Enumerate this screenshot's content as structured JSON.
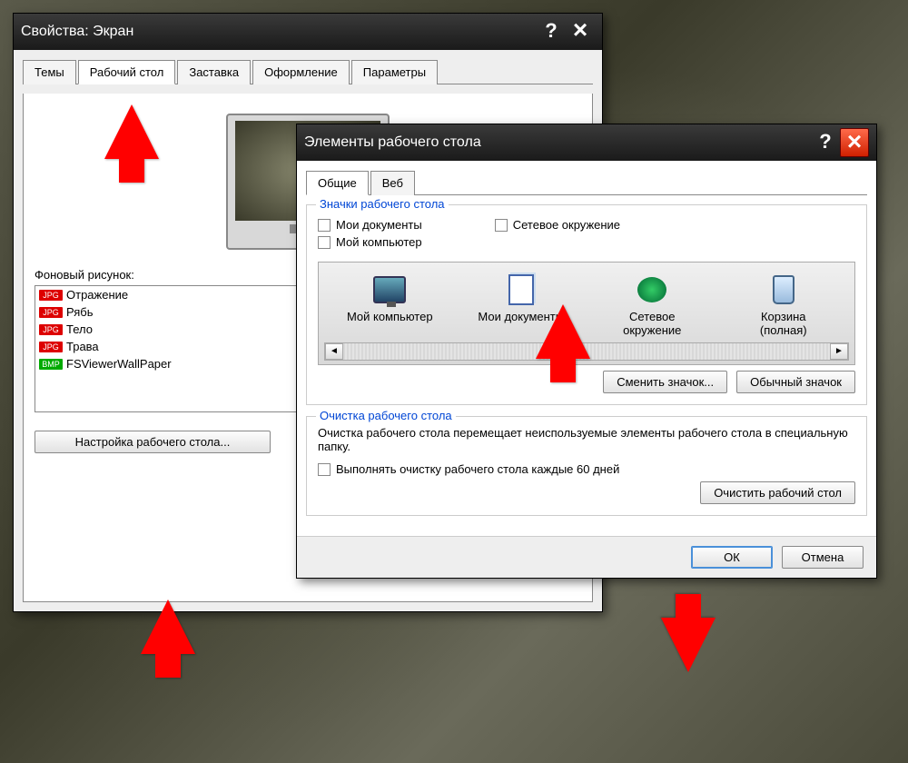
{
  "window1": {
    "title": "Свойства: Экран",
    "tabs": [
      "Темы",
      "Рабочий стол",
      "Заставка",
      "Оформление",
      "Параметры"
    ],
    "active_tab": 1,
    "bg_label": "Фоновый рисунок:",
    "bg_items": [
      {
        "type": "jpg",
        "name": "Отражение"
      },
      {
        "type": "jpg",
        "name": "Рябь"
      },
      {
        "type": "jpg",
        "name": "Тело"
      },
      {
        "type": "jpg",
        "name": "Трава"
      },
      {
        "type": "bmp",
        "name": "FSViewerWallPaper"
      }
    ],
    "desktop_settings_btn": "Настройка рабочего стола..."
  },
  "window2": {
    "title": "Элементы рабочего стола",
    "tabs": [
      "Общие",
      "Веб"
    ],
    "active_tab": 0,
    "icons_group": "Значки рабочего стола",
    "checkboxes": {
      "my_docs": "Мои документы",
      "my_computer": "Мой компьютер",
      "network": "Сетевое окружение"
    },
    "icon_labels": {
      "my_computer": "Мой компьютер",
      "my_docs": "Мои документы",
      "network_line1": "Сетевое",
      "network_line2": "окружение",
      "bin_line1": "Корзина",
      "bin_line2": "(полная)"
    },
    "change_icon_btn": "Сменить значок...",
    "default_icon_btn": "Обычный значок",
    "cleanup_group": "Очистка рабочего стола",
    "cleanup_text": "Очистка рабочего стола перемещает неиспользуемые элементы рабочего стола в специальную папку.",
    "cleanup_checkbox": "Выполнять очистку рабочего стола каждые 60 дней",
    "cleanup_btn": "Очистить рабочий стол",
    "ok_btn": "ОК",
    "cancel_btn": "Отмена"
  }
}
